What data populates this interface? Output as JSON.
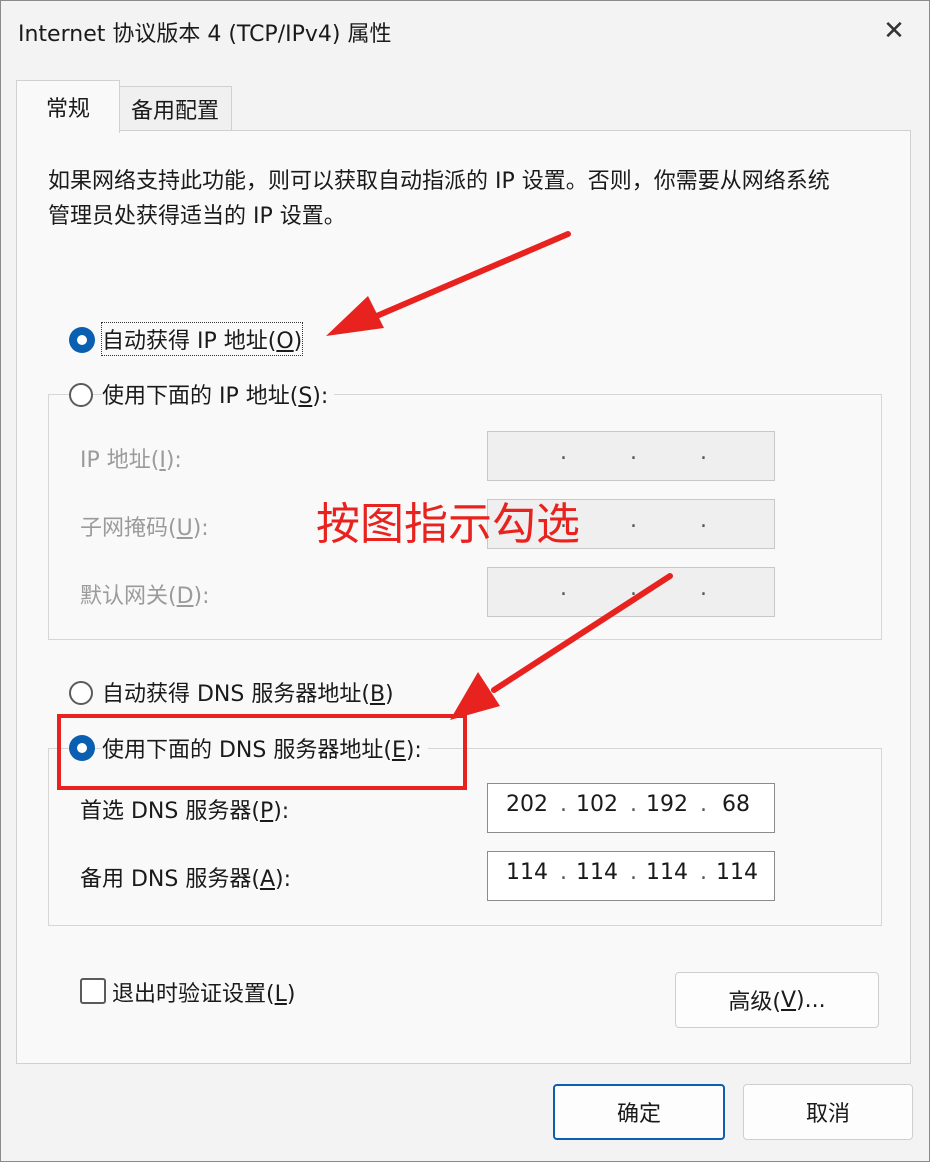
{
  "window": {
    "title": "Internet 协议版本 4 (TCP/IPv4) 属性",
    "close_glyph": "✕"
  },
  "tabs": [
    {
      "label": "常规",
      "active": true
    },
    {
      "label": "备用配置",
      "active": false
    }
  ],
  "description": "如果网络支持此功能，则可以获取自动指派的 IP 设置。否则，你需要从网络系统管理员处获得适当的 IP 设置。",
  "ip_mode": {
    "auto": {
      "label_pre": "自动获得 IP 地址(",
      "key": "O",
      "label_post": ")",
      "selected": true
    },
    "manual": {
      "label_pre": "使用下面的 IP 地址(",
      "key": "S",
      "label_post": "):",
      "selected": false
    }
  },
  "ip_fields": [
    {
      "label_pre": "IP 地址(",
      "key": "I",
      "label_post": "):",
      "octets": [
        "",
        "",
        "",
        ""
      ]
    },
    {
      "label_pre": "子网掩码(",
      "key": "U",
      "label_post": "):",
      "octets": [
        "",
        "",
        "",
        ""
      ]
    },
    {
      "label_pre": "默认网关(",
      "key": "D",
      "label_post": "):",
      "octets": [
        "",
        "",
        "",
        ""
      ]
    }
  ],
  "dns_mode": {
    "auto": {
      "label_pre": "自动获得 DNS 服务器地址(",
      "key": "B",
      "label_post": ")",
      "selected": false
    },
    "manual": {
      "label_pre": "使用下面的 DNS 服务器地址(",
      "key": "E",
      "label_post": "):",
      "selected": true
    }
  },
  "dns_fields": [
    {
      "label_pre": "首选 DNS 服务器(",
      "key": "P",
      "label_post": "):",
      "octets": [
        "202",
        "102",
        "192",
        "68"
      ]
    },
    {
      "label_pre": "备用 DNS 服务器(",
      "key": "A",
      "label_post": "):",
      "octets": [
        "114",
        "114",
        "114",
        "114"
      ]
    }
  ],
  "validate_on_exit": {
    "label_pre": "退出时验证设置(",
    "key": "L",
    "label_post": ")",
    "checked": false
  },
  "advanced_button": {
    "label_pre": "高级(",
    "key": "V",
    "label_post": ")..."
  },
  "ok_label": "确定",
  "cancel_label": "取消",
  "annotation": {
    "text": "按图指示勾选",
    "color": "#e8231f"
  },
  "colors": {
    "accent": "#0a5fb0",
    "annotation_red": "#e8231f"
  }
}
